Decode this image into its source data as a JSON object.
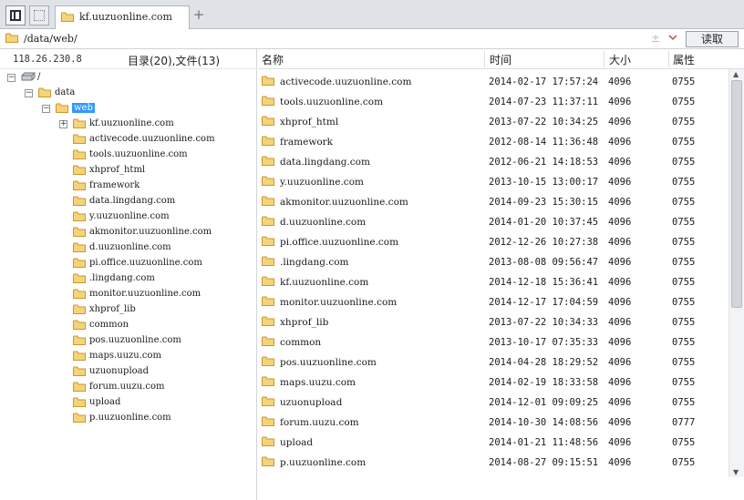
{
  "tabs": {
    "active_label": "kf.uuzuonline.com",
    "add_symbol": "+"
  },
  "pathbar": {
    "path": "/data/web/",
    "read_label": "读取"
  },
  "left": {
    "server_ip": "118.26.230.8",
    "counts": "目录(20),文件(13)",
    "tree": [
      {
        "label": "/",
        "level": 0,
        "expander": "−",
        "icon": "drive-icon"
      },
      {
        "label": "data",
        "level": 1,
        "expander": "−",
        "icon": "folder-icon"
      },
      {
        "label": "web",
        "level": 2,
        "expander": "−",
        "icon": "folder-icon",
        "selected": true
      },
      {
        "label": "kf.uuzuonline.com",
        "level": 3,
        "expander": "+",
        "icon": "folder-icon"
      },
      {
        "label": "activecode.uuzuonline.com",
        "level": 3,
        "icon": "folder-icon"
      },
      {
        "label": "tools.uuzuonline.com",
        "level": 3,
        "icon": "folder-icon"
      },
      {
        "label": "xhprof_html",
        "level": 3,
        "icon": "folder-icon"
      },
      {
        "label": "framework",
        "level": 3,
        "icon": "folder-icon"
      },
      {
        "label": "data.lingdang.com",
        "level": 3,
        "icon": "folder-icon"
      },
      {
        "label": "y.uuzuonline.com",
        "level": 3,
        "icon": "folder-icon"
      },
      {
        "label": "akmonitor.uuzuonline.com",
        "level": 3,
        "icon": "folder-icon"
      },
      {
        "label": "d.uuzuonline.com",
        "level": 3,
        "icon": "folder-icon"
      },
      {
        "label": "pi.office.uuzuonline.com",
        "level": 3,
        "icon": "folder-icon"
      },
      {
        "label": ".lingdang.com",
        "level": 3,
        "icon": "folder-icon"
      },
      {
        "label": "monitor.uuzuonline.com",
        "level": 3,
        "icon": "folder-icon"
      },
      {
        "label": "xhprof_lib",
        "level": 3,
        "icon": "folder-icon"
      },
      {
        "label": "common",
        "level": 3,
        "icon": "folder-icon"
      },
      {
        "label": "pos.uuzuonline.com",
        "level": 3,
        "icon": "folder-icon"
      },
      {
        "label": "maps.uuzu.com",
        "level": 3,
        "icon": "folder-icon"
      },
      {
        "label": "uzuonupload",
        "level": 3,
        "icon": "folder-icon"
      },
      {
        "label": "forum.uuzu.com",
        "level": 3,
        "icon": "folder-icon"
      },
      {
        "label": "upload",
        "level": 3,
        "icon": "folder-icon"
      },
      {
        "label": "p.uuzuonline.com",
        "level": 3,
        "icon": "folder-icon"
      }
    ]
  },
  "columns": {
    "name": "名称",
    "time": "时间",
    "size": "大小",
    "perm": "属性"
  },
  "files": [
    {
      "name": "activecode.uuzuonline.com",
      "time": "2014-02-17 17:57:24",
      "size": "4096",
      "perm": "0755"
    },
    {
      "name": "tools.uuzuonline.com",
      "time": "2014-07-23 11:37:11",
      "size": "4096",
      "perm": "0755"
    },
    {
      "name": "xhprof_html",
      "time": "2013-07-22 10:34:25",
      "size": "4096",
      "perm": "0755"
    },
    {
      "name": "framework",
      "time": "2012-08-14 11:36:48",
      "size": "4096",
      "perm": "0755"
    },
    {
      "name": "data.lingdang.com",
      "time": "2012-06-21 14:18:53",
      "size": "4096",
      "perm": "0755"
    },
    {
      "name": "y.uuzuonline.com",
      "time": "2013-10-15 13:00:17",
      "size": "4096",
      "perm": "0755"
    },
    {
      "name": "akmonitor.uuzuonline.com",
      "time": "2014-09-23 15:30:15",
      "size": "4096",
      "perm": "0755"
    },
    {
      "name": "d.uuzuonline.com",
      "time": "2014-01-20 10:37:45",
      "size": "4096",
      "perm": "0755"
    },
    {
      "name": "pi.office.uuzuonline.com",
      "time": "2012-12-26 10:27:38",
      "size": "4096",
      "perm": "0755"
    },
    {
      "name": ".lingdang.com",
      "time": "2013-08-08 09:56:47",
      "size": "4096",
      "perm": "0755"
    },
    {
      "name": "kf.uuzuonline.com",
      "time": "2014-12-18 15:36:41",
      "size": "4096",
      "perm": "0755"
    },
    {
      "name": "monitor.uuzuonline.com",
      "time": "2014-12-17 17:04:59",
      "size": "4096",
      "perm": "0755"
    },
    {
      "name": "xhprof_lib",
      "time": "2013-07-22 10:34:33",
      "size": "4096",
      "perm": "0755"
    },
    {
      "name": "common",
      "time": "2013-10-17 07:35:33",
      "size": "4096",
      "perm": "0755"
    },
    {
      "name": "pos.uuzuonline.com",
      "time": "2014-04-28 18:29:52",
      "size": "4096",
      "perm": "0755"
    },
    {
      "name": "maps.uuzu.com",
      "time": "2014-02-19 18:33:58",
      "size": "4096",
      "perm": "0755"
    },
    {
      "name": "uzuonupload",
      "time": "2014-12-01 09:09:25",
      "size": "4096",
      "perm": "0755"
    },
    {
      "name": "forum.uuzu.com",
      "time": "2014-10-30 14:08:56",
      "size": "4096",
      "perm": "0777"
    },
    {
      "name": "upload",
      "time": "2014-01-21 11:48:56",
      "size": "4096",
      "perm": "0755"
    },
    {
      "name": "p.uuzuonline.com",
      "time": "2014-08-27 09:15:51",
      "size": "4096",
      "perm": "0755"
    }
  ],
  "colors": {
    "folder_fill": "#f5d37a",
    "folder_stroke": "#c79a2d",
    "selection": "#3399ff",
    "accent_red": "#c0392b"
  }
}
